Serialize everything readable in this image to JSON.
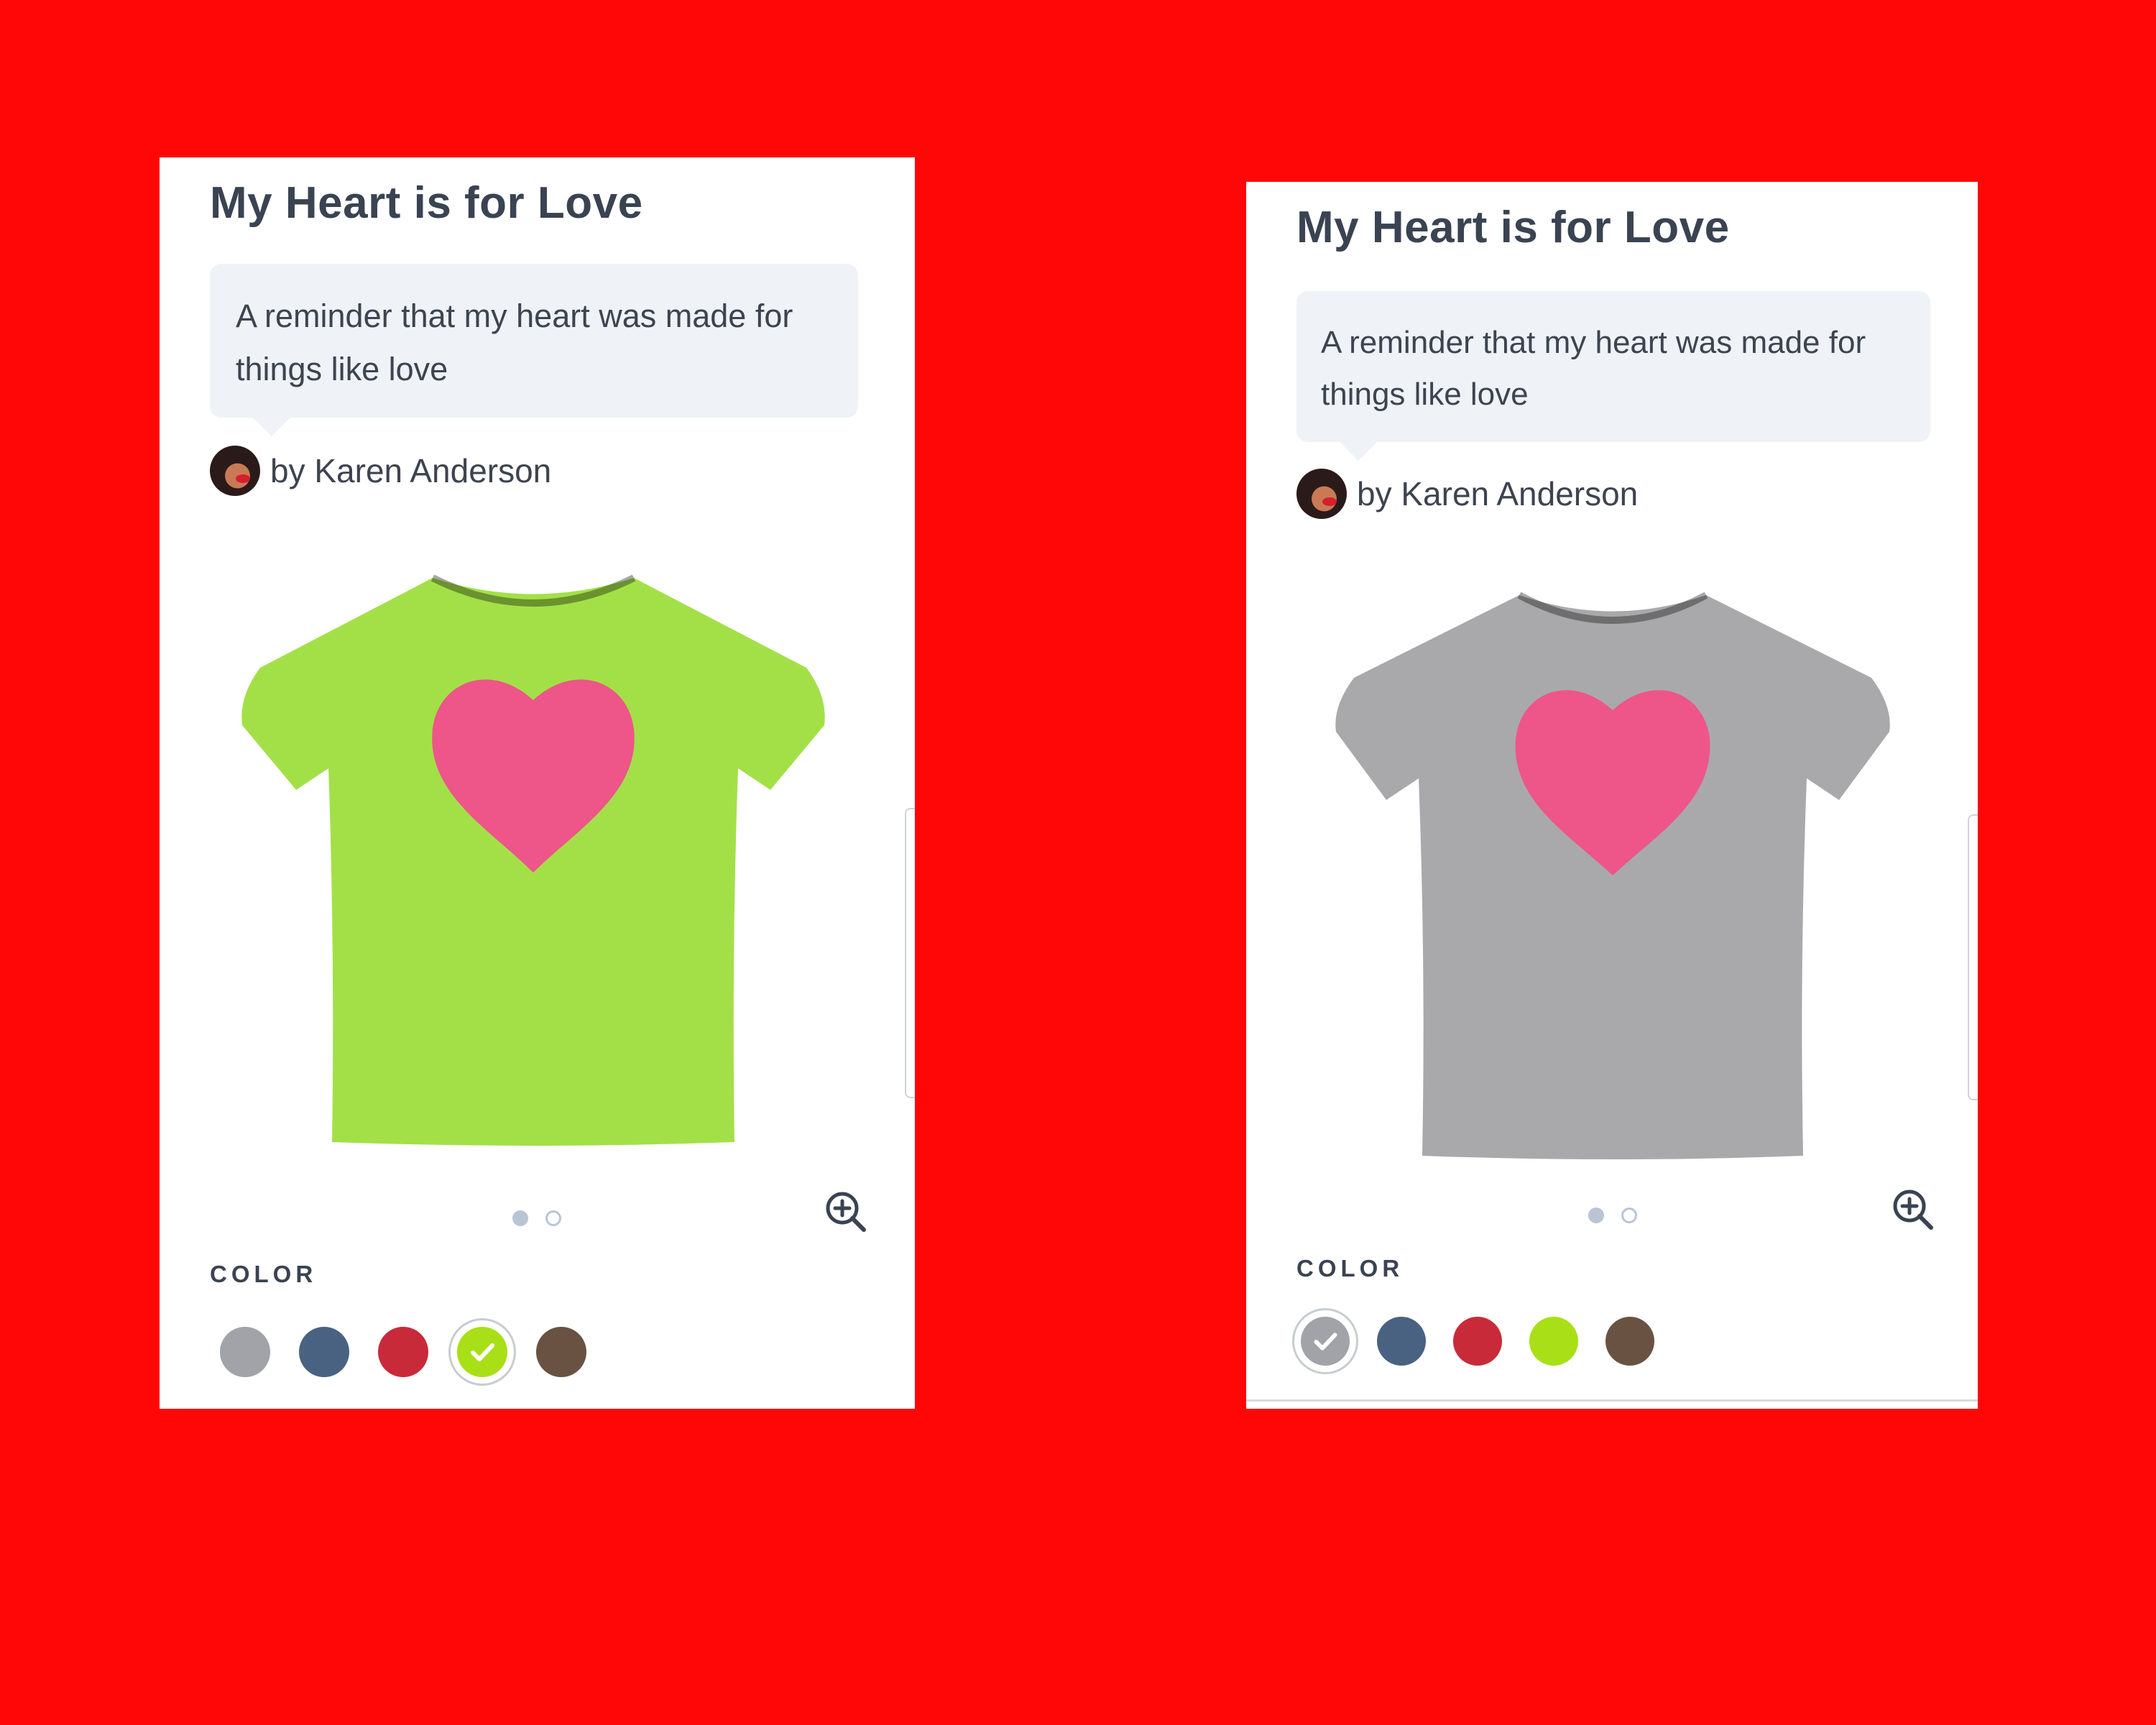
{
  "background_color": "#ff0707",
  "cards": [
    {
      "title": "My Heart is for Love",
      "description": "A reminder that my heart was made for things like love",
      "author": "by Karen Anderson",
      "shirt_color": "#a3e048",
      "heart_color": "#ee5589",
      "color_section_label": "COLOR",
      "swatches": [
        {
          "name": "gray",
          "color": "#a2a3a8",
          "selected": false
        },
        {
          "name": "navy",
          "color": "#4a6282",
          "selected": false
        },
        {
          "name": "red",
          "color": "#c92a3a",
          "selected": false
        },
        {
          "name": "lime",
          "color": "#a9df16",
          "selected": true
        },
        {
          "name": "brown",
          "color": "#6a5242",
          "selected": false
        }
      ],
      "pager": {
        "pages": 2,
        "current": 1
      },
      "zoom_icon": "zoom-in-icon"
    },
    {
      "title": "My Heart is for Love",
      "description": "A reminder that my heart was made for things like love",
      "author": "by Karen Anderson",
      "shirt_color": "#a9a9ab",
      "heart_color": "#ee5589",
      "color_section_label": "COLOR",
      "swatches": [
        {
          "name": "gray",
          "color": "#a2a3a8",
          "selected": true
        },
        {
          "name": "navy",
          "color": "#4a6282",
          "selected": false
        },
        {
          "name": "red",
          "color": "#c92a3a",
          "selected": false
        },
        {
          "name": "lime",
          "color": "#a9df16",
          "selected": false
        },
        {
          "name": "brown",
          "color": "#6a5242",
          "selected": false
        }
      ],
      "pager": {
        "pages": 2,
        "current": 1
      },
      "zoom_icon": "zoom-in-icon"
    }
  ]
}
